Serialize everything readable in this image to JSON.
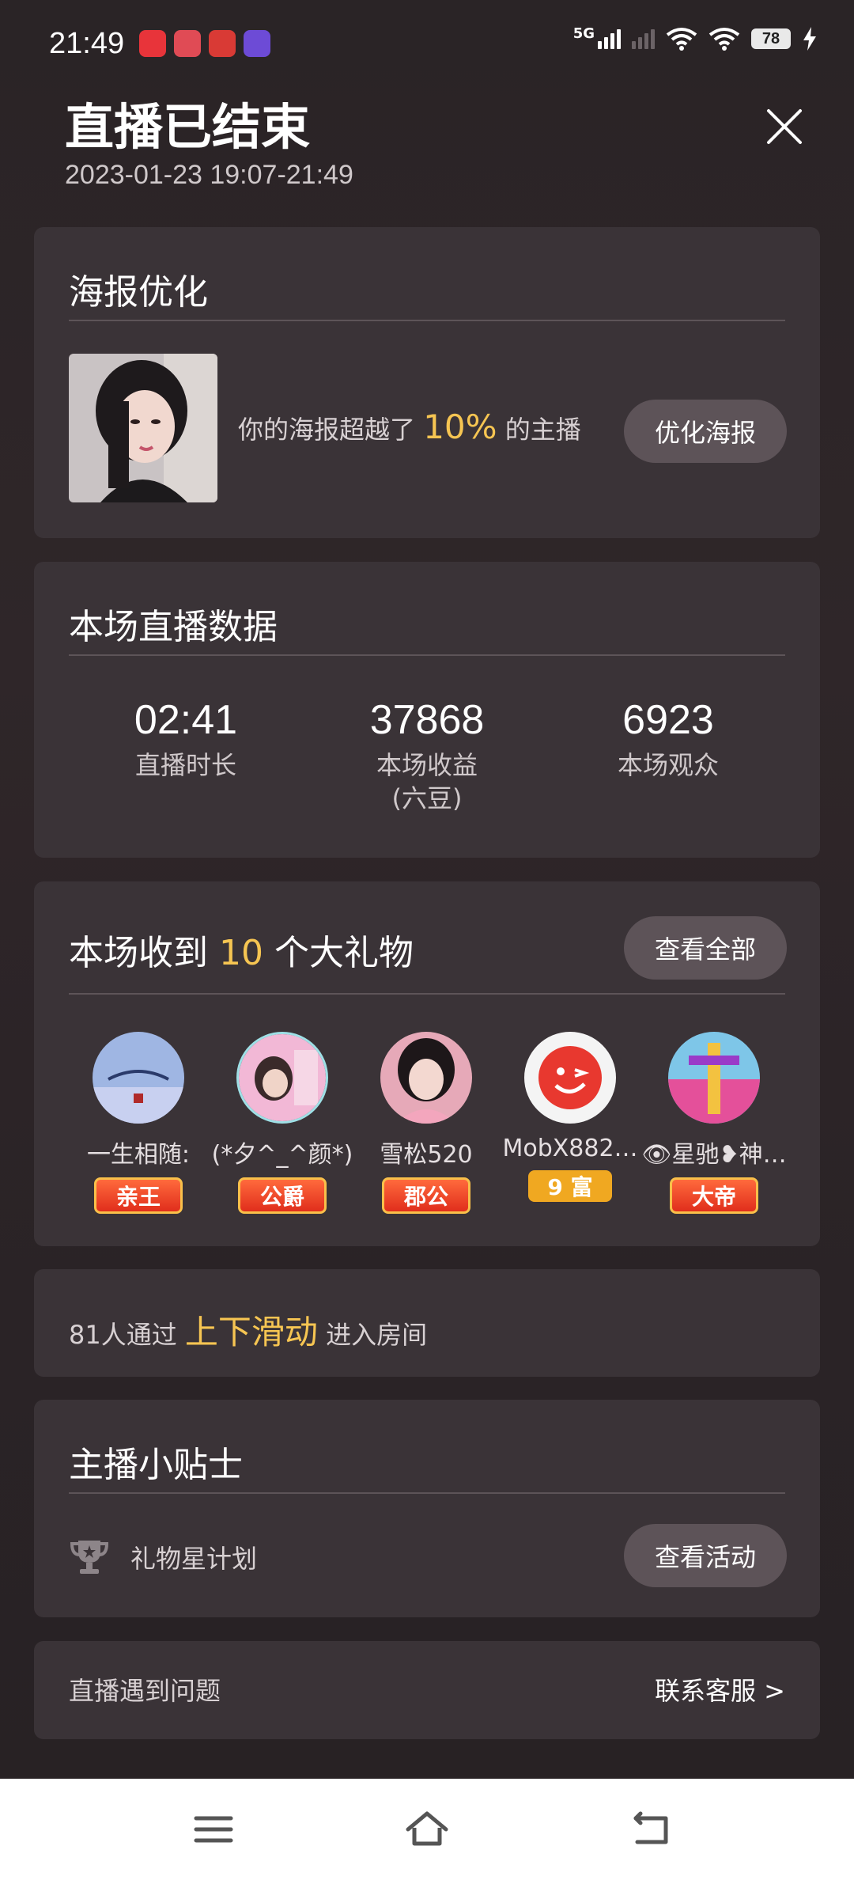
{
  "status_bar": {
    "time": "21:49",
    "network": "5G",
    "battery": "78"
  },
  "header": {
    "title": "直播已结束",
    "date_range": "2023-01-23 19:07-21:49"
  },
  "poster_card": {
    "title": "海报优化",
    "text_prefix": "你的海报超越了",
    "percent": "10%",
    "text_suffix": "的主播",
    "button": "优化海报"
  },
  "stats_card": {
    "title": "本场直播数据",
    "items": [
      {
        "value": "02:41",
        "label": "直播时长"
      },
      {
        "value": "37868",
        "label": "本场收益",
        "sub": "(六豆)"
      },
      {
        "value": "6923",
        "label": "本场观众"
      }
    ]
  },
  "gifts_card": {
    "title_prefix": "本场收到",
    "count": "10",
    "title_suffix": "个大礼物",
    "button": "查看全部",
    "gifters": [
      {
        "name": "一生相随:",
        "badge": "亲王",
        "badge_style": "red"
      },
      {
        "name": "(*夕^_^颜*)",
        "badge": "公爵",
        "badge_style": "red"
      },
      {
        "name": "雪松520",
        "badge": "郡公",
        "badge_style": "red"
      },
      {
        "name": "MobX882…",
        "badge": "9 富",
        "badge_style": "gold"
      },
      {
        "name": "👁星驰❥神…",
        "badge": "大帝",
        "badge_style": "red"
      }
    ]
  },
  "swipe_card": {
    "prefix": "81人通过",
    "highlight": "上下滑动",
    "suffix": "进入房间"
  },
  "tips_card": {
    "title": "主播小贴士",
    "item_label": "礼物星计划",
    "button": "查看活动"
  },
  "help_card": {
    "label": "直播遇到问题",
    "link": "联系客服 >"
  },
  "colors": {
    "highlight": "#f6c552",
    "card_bg": "#3a3337",
    "button_bg": "#5d5358"
  }
}
